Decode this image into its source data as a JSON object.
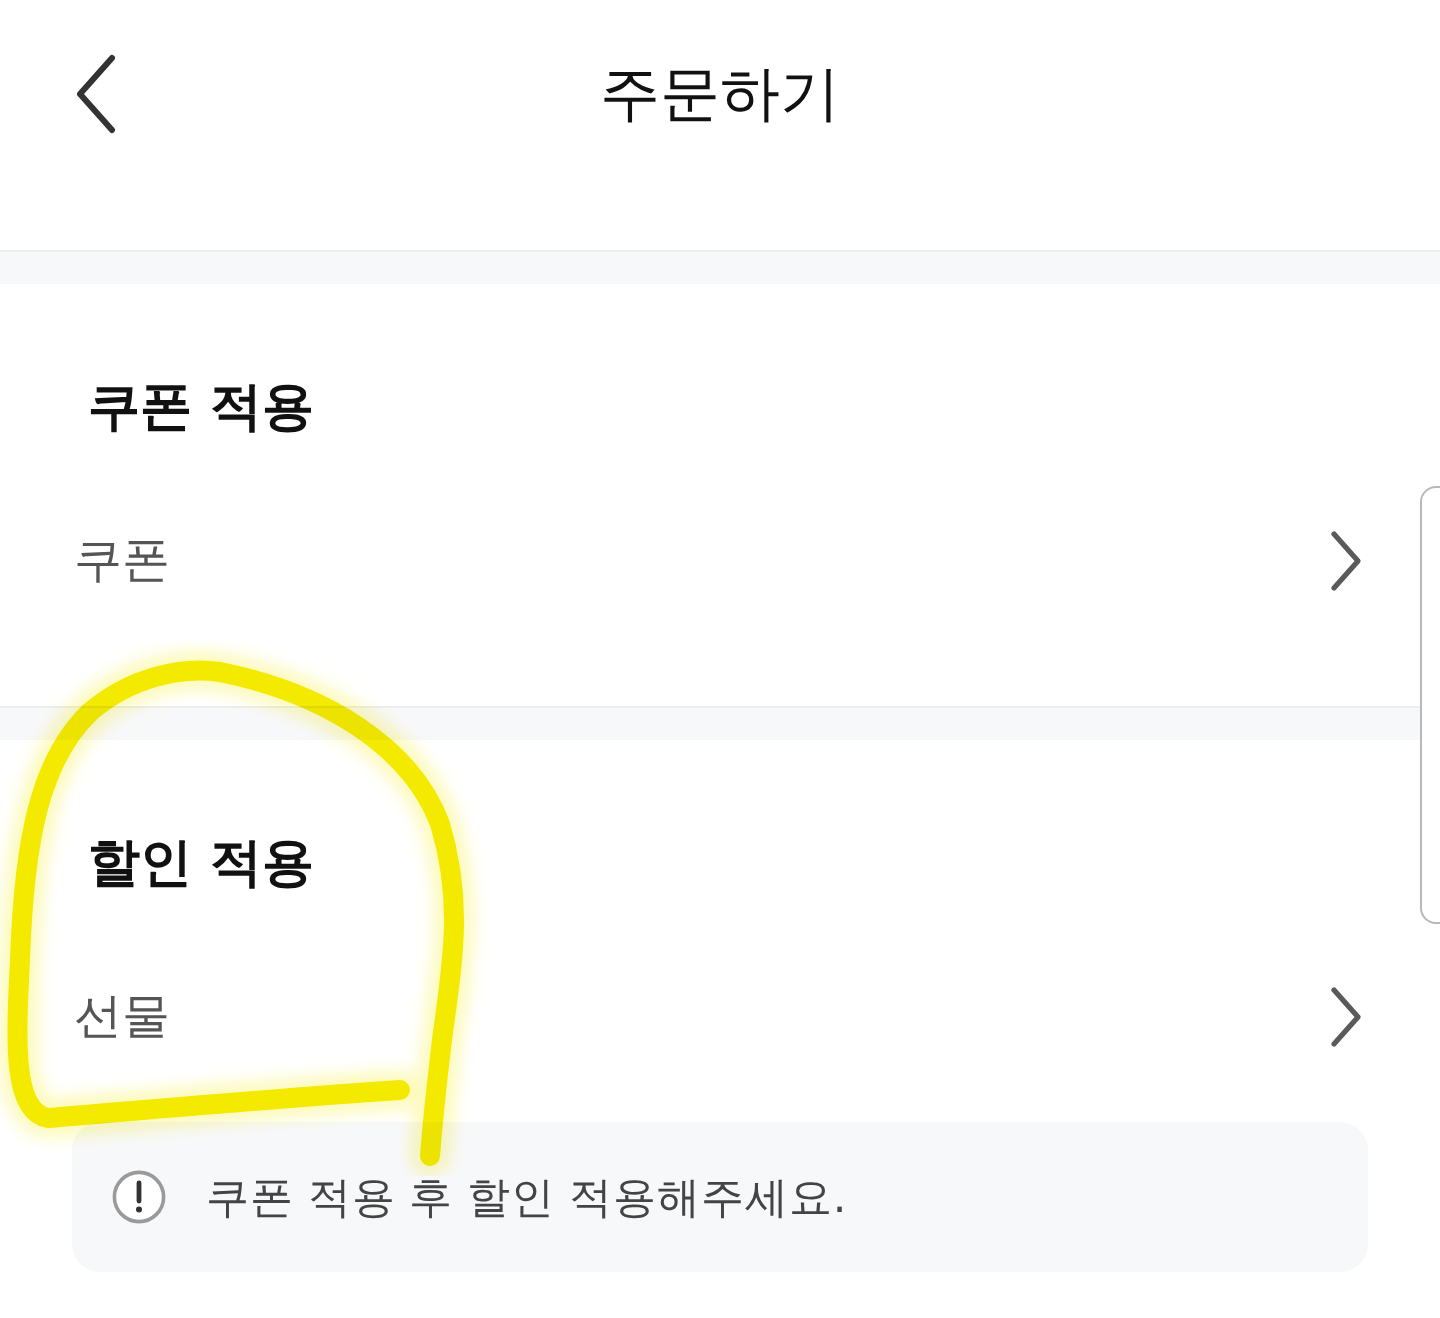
{
  "header": {
    "title": "주문하기"
  },
  "sections": [
    {
      "heading": "쿠폰 적용",
      "rows": [
        {
          "label": "쿠폰"
        }
      ]
    },
    {
      "heading": "할인 적용",
      "rows": [
        {
          "label": "선물"
        }
      ]
    }
  ],
  "notice": {
    "text": "쿠폰 적용 후 할인 적용해주세요."
  }
}
